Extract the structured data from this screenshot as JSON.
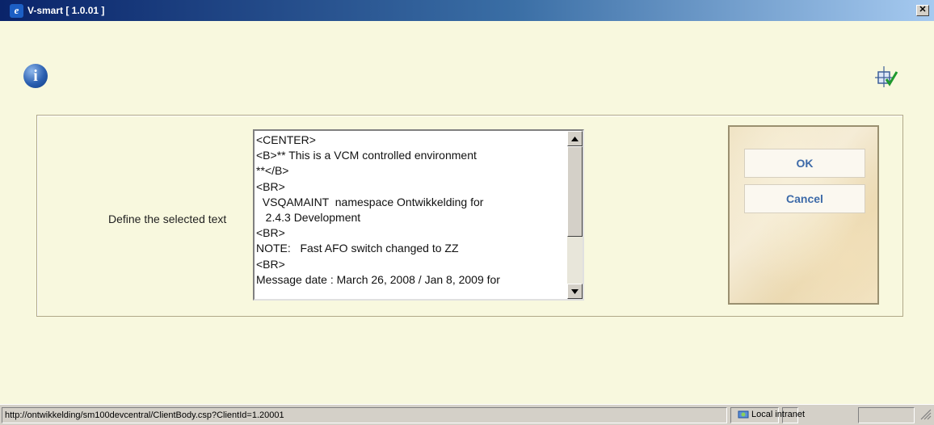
{
  "window": {
    "title": "V-smart [ 1.0.01 ]",
    "app_icon": "ie-icon",
    "close_glyph": "✕"
  },
  "form": {
    "label": "Define the selected text",
    "text_value": "<CENTER>\n<B>** This is a VCM controlled environment\n**</B>\n<BR>\n  VSQAMAINT  namespace Ontwikkelding for\n   2.4.3 Development\n<BR>\nNOTE:   Fast AFO switch changed to ZZ\n<BR>\nMessage date : March 26, 2008 / Jan 8, 2009 for"
  },
  "icons": {
    "info": "info-icon",
    "layout": "layout-check-icon",
    "info_glyph": "i"
  },
  "buttons": {
    "ok_label": "OK",
    "cancel_label": "Cancel"
  },
  "statusbar": {
    "url": "http://ontwikkelding/sm100devcentral/ClientBody.csp?ClientId=1.20001",
    "zone": "Local intranet"
  },
  "colors": {
    "background": "#f8f8de",
    "button_text": "#3d6aa8",
    "titlebar_start": "#0a246a"
  }
}
